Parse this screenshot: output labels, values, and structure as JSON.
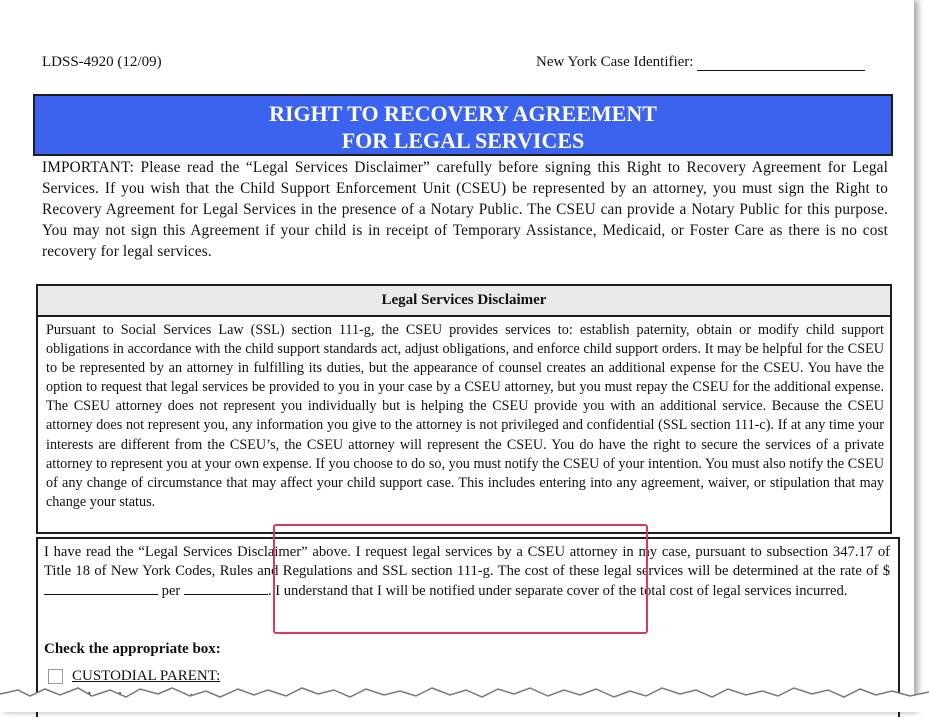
{
  "header": {
    "form_id": "LDSS-4920 (12/09)",
    "case_identifier_label": "New York Case Identifier:"
  },
  "title": {
    "line1": "RIGHT TO RECOVERY AGREEMENT",
    "line2": "FOR LEGAL SERVICES"
  },
  "important_text": "IMPORTANT: Please read the “Legal Services Disclaimer” carefully before signing this Right to Recovery Agreement for Legal Services. If you wish that the Child Support Enforcement Unit (CSEU) be represented by an attorney, you must sign the Right to Recovery Agreement for Legal Services in the presence of a Notary Public. The CSEU can provide a Notary Public for this purpose. You may not sign this Agreement if your child is in receipt of Temporary Assistance, Medicaid, or Foster Care as there is no cost recovery for legal services.",
  "disclaimer": {
    "heading": "Legal Services Disclaimer",
    "body": "Pursuant to Social Services Law (SSL) section 111-g, the CSEU provides services to: establish paternity, obtain or modify child support obligations in accordance with the child support standards act, adjust obligations, and enforce child support orders. It may be helpful for the CSEU to be represented by an attorney in fulfilling its duties, but the appearance of counsel creates an additional expense for the CSEU. You have the option to request that legal services be provided to you in your case by a CSEU attorney, but you must repay the CSEU for the additional expense. The CSEU attorney does not represent you individually but is helping the CSEU provide you with an additional service. Because the CSEU attorney does not represent you, any information you give to the attorney is not privileged and confidential (SSL section 111-c). If at any time your interests are different from the CSEU’s, the CSEU attorney will represent the CSEU. You do have the right to secure the services of a private attorney to represent you at your own expense. If you choose to do so, you must notify the CSEU of your intention. You must also notify the CSEU of any change of circumstance that may affect your child support case. This includes entering into any agreement, waiver, or stipulation that may change your status."
  },
  "request": {
    "text_before": "I have read the “Legal Services Disclaimer” above. I request legal services by a CSEU attorney in my case, pursuant to subsection 347.17 of Title 18 of New York Codes, Rules and Regulations and SSL section 111-g. The cost of these legal services will be determined at the rate of $",
    "per_word": "per",
    "text_after": ". I understand that I will be notified under separate cover of the total cost of legal services incurred.",
    "check_label": "Check the appropriate box:",
    "custodial_label": "CUSTODIAL PARENT:",
    "partial_text": "To    ov         f  l  t           i        l        h  t  i                                     C  SEU             t       d"
  },
  "colors": {
    "title_bg": "#3b63ee",
    "highlight": "#d73a5a",
    "disclaimer_head_bg": "#eaeaea"
  }
}
